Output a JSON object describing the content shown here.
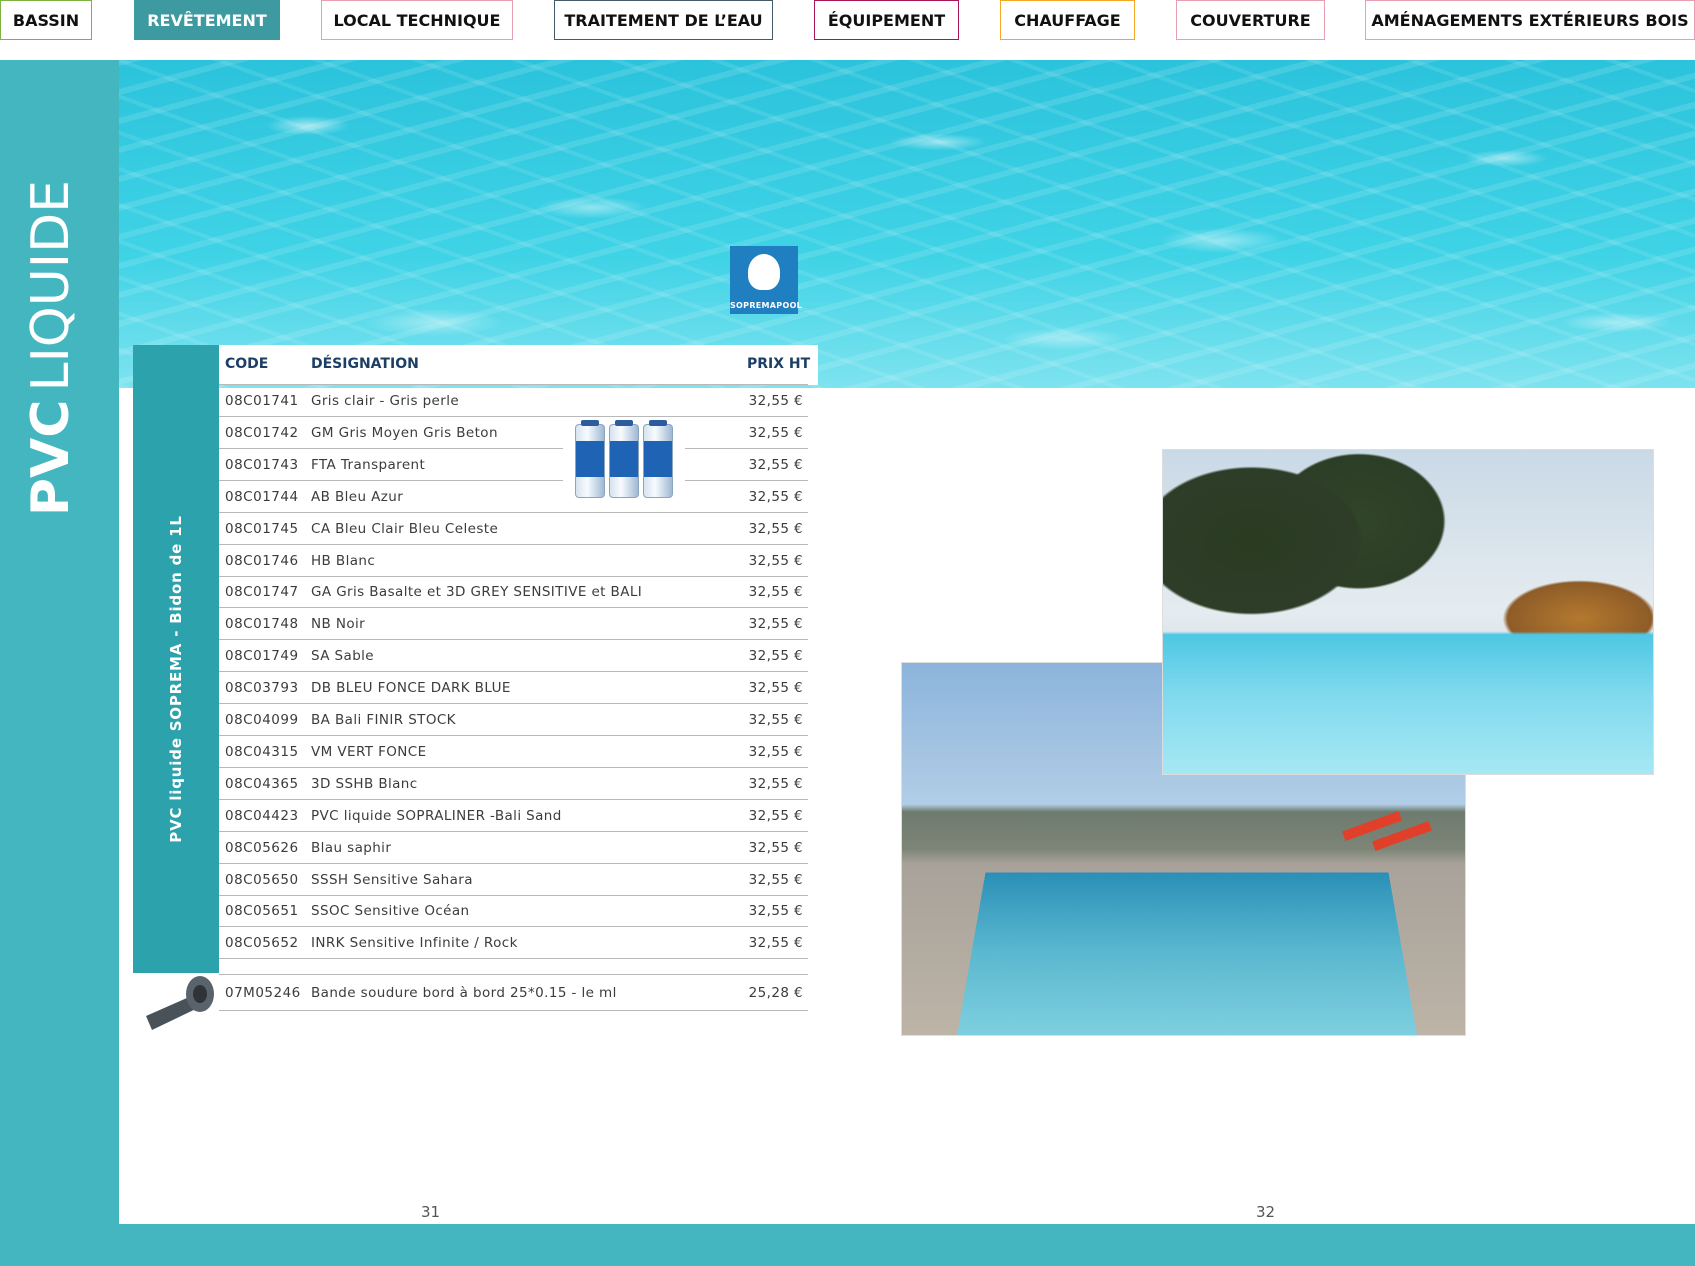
{
  "nav": {
    "tabs": [
      {
        "label": "BASSIN",
        "color": "#7cb342"
      },
      {
        "label": "REVÊTEMENT",
        "color": "#3d9aa1"
      },
      {
        "label": "LOCAL TECHNIQUE",
        "color": "#e8a0b0"
      },
      {
        "label": "TRAITEMENT DE L’EAU",
        "color": "#455a64"
      },
      {
        "label": "ÉQUIPEMENT",
        "color": "#ad1457"
      },
      {
        "label": "CHAUFFAGE",
        "color": "#f5a623"
      },
      {
        "label": "COUVERTURE",
        "color": "#e8a0b0"
      },
      {
        "label": "AMÉNAGEMENTS EXTÉRIEURS BOIS",
        "color": "#e8a0b0"
      }
    ],
    "active_index": 1
  },
  "section_title": {
    "bold": "PVC",
    "light": "LIQUIDE"
  },
  "logo": {
    "text": "SOPREMAPOOL"
  },
  "table": {
    "headers": {
      "code": "CODE",
      "designation": "DÉSIGNATION",
      "price": "PRIX HT"
    },
    "group_label": "PVC liquide SOPREMA - Bidon de 1L",
    "rows": [
      {
        "code": "08C01741",
        "designation": "Gris clair - Gris perle",
        "price": "32,55 €"
      },
      {
        "code": "08C01742",
        "designation": "GM Gris Moyen Gris Beton",
        "price": "32,55 €"
      },
      {
        "code": "08C01743",
        "designation": "FTA Transparent",
        "price": "32,55 €"
      },
      {
        "code": "08C01744",
        "designation": "AB Bleu Azur",
        "price": "32,55 €"
      },
      {
        "code": "08C01745",
        "designation": "CA Bleu Clair Bleu Celeste",
        "price": "32,55 €"
      },
      {
        "code": "08C01746",
        "designation": "HB Blanc",
        "price": "32,55 €"
      },
      {
        "code": "08C01747",
        "designation": "GA Gris Basalte et 3D GREY SENSITIVE et BALI",
        "price": "32,55 €"
      },
      {
        "code": "08C01748",
        "designation": "NB Noir",
        "price": "32,55 €"
      },
      {
        "code": "08C01749",
        "designation": "SA Sable",
        "price": "32,55 €"
      },
      {
        "code": "08C03793",
        "designation": "DB BLEU FONCE DARK BLUE",
        "price": "32,55 €"
      },
      {
        "code": "08C04099",
        "designation": "BA Bali  FINIR STOCK",
        "price": "32,55 €"
      },
      {
        "code": "08C04315",
        "designation": "VM VERT FONCE",
        "price": "32,55 €"
      },
      {
        "code": "08C04365",
        "designation": "3D SSHB Blanc",
        "price": "32,55 €"
      },
      {
        "code": "08C04423",
        "designation": "PVC liquide SOPRALINER -Bali Sand",
        "price": "32,55 €"
      },
      {
        "code": "08C05626",
        "designation": "Blau saphir",
        "price": "32,55 €"
      },
      {
        "code": "08C05650",
        "designation": "SSSH Sensitive Sahara",
        "price": "32,55 €"
      },
      {
        "code": "08C05651",
        "designation": "SSOC Sensitive Océan",
        "price": "32,55 €"
      },
      {
        "code": "08C05652",
        "designation": "INRK Sensitive Infinite / Rock",
        "price": "32,55 €"
      }
    ],
    "extra_row": {
      "code": "07M05246",
      "designation": "Bande soudure bord à bord 25*0.15 - le ml",
      "price": "25,28 €"
    }
  },
  "pages": {
    "left": "31",
    "right": "32"
  },
  "colors": {
    "accent": "#43b6c0",
    "accent_dark": "#2ba2ac",
    "header_text": "#1d3f66"
  }
}
